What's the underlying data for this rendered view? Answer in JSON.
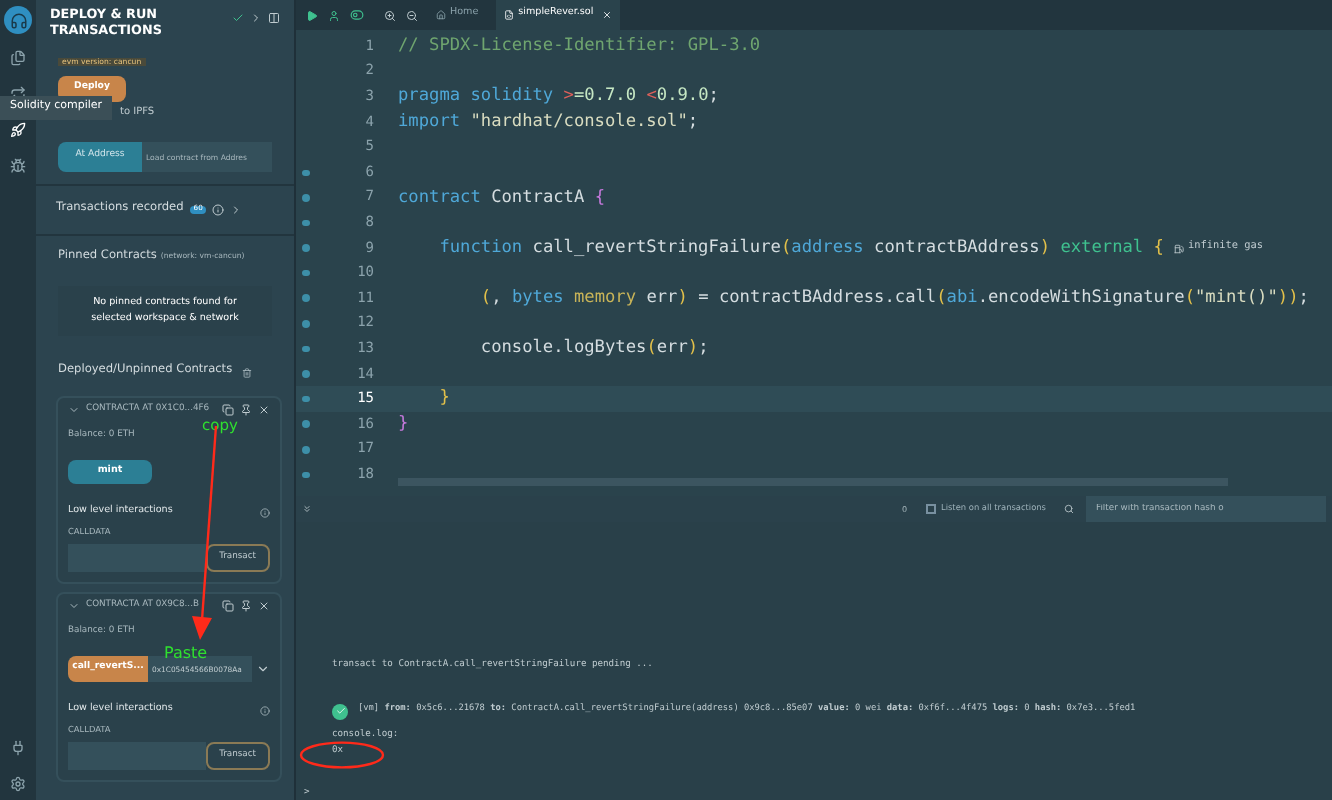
{
  "icon_bar": {
    "tooltip": "Solidity compiler",
    "items": [
      {
        "kind": "files",
        "selected": false
      },
      {
        "kind": "compiler",
        "selected": false
      },
      {
        "kind": "deploy",
        "selected": true
      },
      {
        "kind": "debug",
        "selected": false
      }
    ],
    "bottom": [
      {
        "kind": "plugin"
      },
      {
        "kind": "settings"
      }
    ]
  },
  "panel": {
    "title": "DEPLOY & RUN TRANSACTIONS",
    "evm_badge": "evm version: cancun",
    "deploy_button": "Deploy",
    "publish_label": "to IPFS",
    "at_address_button": "At Address",
    "load_placeholder": "Load contract from Addres",
    "transactions": {
      "label": "Transactions recorded",
      "count": "60"
    },
    "pinned": {
      "title": "Pinned Contracts",
      "network": "(network: vm-cancun)",
      "empty": "No pinned contracts found for selected workspace & network"
    },
    "deployed_title": "Deployed/Unpinned Contracts",
    "contracts": [
      {
        "name": "CONTRACTA AT 0X1C0...4F6",
        "expanded": true,
        "balance": "Balance: 0 ETH",
        "functions": [
          {
            "label": "mint",
            "kind": "transact"
          }
        ],
        "low_level": "Low level interactions",
        "calldata": "CALLDATA",
        "transact": "Transact"
      },
      {
        "name": "CONTRACTA AT 0X9C8...B",
        "expanded": true,
        "balance": "Balance: 0 ETH",
        "functions": [
          {
            "label": "call_revertS...",
            "kind": "payable",
            "value": "0x1C05454566B0078Aa"
          }
        ],
        "low_level": "Low level interactions",
        "calldata": "CALLDATA",
        "transact": "Transact"
      }
    ]
  },
  "editor": {
    "tabs": [
      {
        "label": "Home",
        "kind": "home",
        "selected": false
      },
      {
        "label": "simpleRever.sol",
        "kind": "file",
        "selected": true
      }
    ],
    "lines": [
      {
        "no": "1",
        "marker": false,
        "current": false,
        "tokens": [
          {
            "text": "// SPDX-License-Identifier: GPL-3.0",
            "kind": "comment"
          }
        ]
      },
      {
        "no": "2",
        "marker": false,
        "current": false
      },
      {
        "no": "3",
        "marker": false,
        "current": false,
        "tokens": [
          {
            "text": "pragma solidity ",
            "kind": "keyword"
          },
          {
            "text": ">",
            "kind": "op"
          },
          {
            "text": "=0.7.0 ",
            "kind": "number"
          },
          {
            "text": "<",
            "kind": "op"
          },
          {
            "text": "0.9.0",
            "kind": "number"
          },
          {
            "text": ";",
            "kind": "plain"
          }
        ]
      },
      {
        "no": "4",
        "marker": false,
        "current": false,
        "tokens": [
          {
            "text": "import ",
            "kind": "keyword"
          },
          {
            "text": "\"hardhat/console.sol\"",
            "kind": "string"
          },
          {
            "text": ";",
            "kind": "plain"
          }
        ]
      },
      {
        "no": "5",
        "marker": false,
        "current": false
      },
      {
        "no": "6",
        "marker": true,
        "current": false
      },
      {
        "no": "7",
        "marker": true,
        "current": false,
        "tokens": [
          {
            "text": "contract ",
            "kind": "keyword"
          },
          {
            "text": "ContractA ",
            "kind": "plain"
          },
          {
            "text": "{",
            "kind": "brace"
          }
        ]
      },
      {
        "no": "8",
        "marker": true,
        "current": false
      },
      {
        "no": "9",
        "marker": true,
        "current": false,
        "tokens": [
          {
            "text": "    function ",
            "kind": "keyword"
          },
          {
            "text": "call_revertStringFailure",
            "kind": "plain"
          },
          {
            "text": "(",
            "kind": "paren"
          },
          {
            "text": "address ",
            "kind": "keyword"
          },
          {
            "text": "contractBAddress",
            "kind": "plain"
          },
          {
            "text": ") ",
            "kind": "paren"
          },
          {
            "text": "external ",
            "kind": "modifier"
          },
          {
            "text": "{",
            "kind": "paren"
          }
        ],
        "hint": "infinite gas"
      },
      {
        "no": "10",
        "marker": true,
        "current": false
      },
      {
        "no": "11",
        "marker": true,
        "current": false,
        "tokens": [
          {
            "text": "        (",
            "kind": "paren"
          },
          {
            "text": ", ",
            "kind": "plain"
          },
          {
            "text": "bytes ",
            "kind": "keyword"
          },
          {
            "text": "memory ",
            "kind": "storage"
          },
          {
            "text": "err",
            "kind": "plain"
          },
          {
            "text": ")",
            "kind": "paren"
          },
          {
            "text": " = contractBAddress.call",
            "kind": "plain"
          },
          {
            "text": "(",
            "kind": "paren"
          },
          {
            "text": "abi",
            "kind": "keyword"
          },
          {
            "text": ".encodeWithSignature",
            "kind": "plain"
          },
          {
            "text": "(",
            "kind": "paren"
          },
          {
            "text": "\"mint()\"",
            "kind": "string"
          },
          {
            "text": "))",
            "kind": "paren"
          },
          {
            "text": ";",
            "kind": "plain"
          }
        ]
      },
      {
        "no": "12",
        "marker": true,
        "current": false
      },
      {
        "no": "13",
        "marker": true,
        "current": false,
        "tokens": [
          {
            "text": "        console.logBytes",
            "kind": "plain"
          },
          {
            "text": "(",
            "kind": "paren"
          },
          {
            "text": "err",
            "kind": "plain"
          },
          {
            "text": ")",
            "kind": "paren"
          },
          {
            "text": ";",
            "kind": "plain"
          }
        ]
      },
      {
        "no": "14",
        "marker": true,
        "current": false
      },
      {
        "no": "15",
        "marker": true,
        "current": true,
        "tokens": [
          {
            "text": "    }",
            "kind": "paren"
          }
        ]
      },
      {
        "no": "16",
        "marker": true,
        "current": false,
        "tokens": [
          {
            "text": "}",
            "kind": "brace"
          }
        ]
      },
      {
        "no": "17",
        "marker": true,
        "current": false
      },
      {
        "no": "18",
        "marker": true,
        "current": false
      }
    ]
  },
  "terminal": {
    "count": "0",
    "listen_label": "Listen on all transactions",
    "listen_checked": false,
    "filter_placeholder": "Filter with transaction hash o",
    "pending": "transact to ContractA.call_revertStringFailure pending ...",
    "log": "[vm] **from:** 0x5c6...21678 **to:** ContractA.call_revertStringFailure(address) 0x9c8...85e07 **value:** 0 wei **data:** 0xf6f...4f475 **logs:** 0 **hash:** 0x7e3...5fed1",
    "log_success": true,
    "console_label": "console.log:",
    "console_value": "0x",
    "prompt": ">"
  },
  "annotations": {
    "copy": "copy",
    "paste": "Paste"
  }
}
